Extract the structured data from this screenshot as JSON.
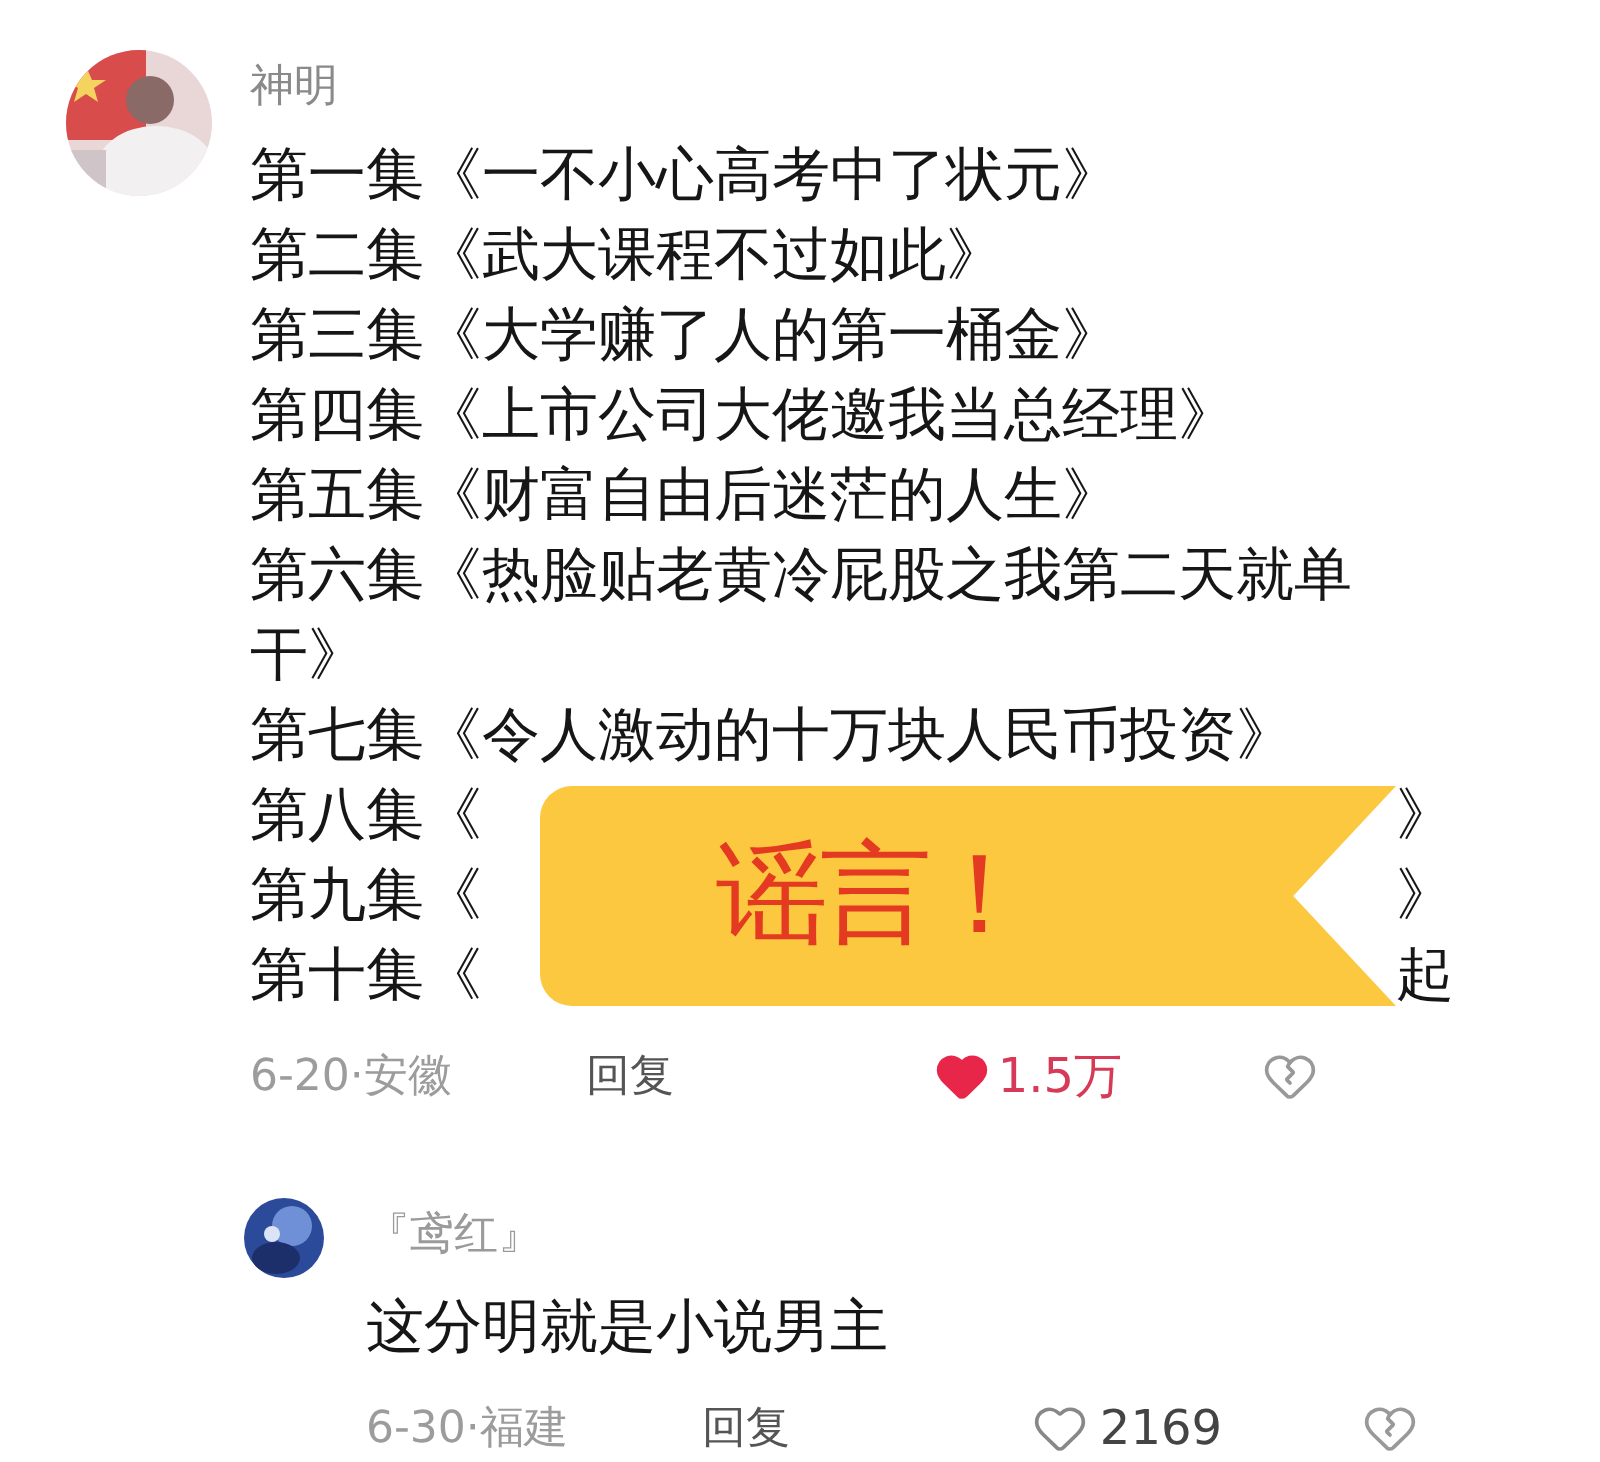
{
  "comments": [
    {
      "kind": "top",
      "name": "神明",
      "lines": [
        {
          "kind": "full",
          "text": "第一集《一不小心高考中了状元》"
        },
        {
          "kind": "full",
          "text": "第二集《武大课程不过如此》"
        },
        {
          "kind": "full",
          "text": "第三集《大学赚了人的第一桶金》"
        },
        {
          "kind": "full",
          "text": "第四集《上市公司大佬邀我当总经理》"
        },
        {
          "kind": "full",
          "text": "第五集《财富自由后迷茫的人生》"
        },
        {
          "kind": "full",
          "text": "第六集《热脸贴老黄冷屁股之我第二天就单干》"
        },
        {
          "kind": "full",
          "text": "第七集《令人激动的十万块人民币投资》"
        },
        {
          "kind": "covered",
          "left": "第八集《",
          "right": "》"
        },
        {
          "kind": "covered",
          "left": "第九集《",
          "right": "》"
        },
        {
          "kind": "covered",
          "left": "第十集《",
          "right": "起"
        }
      ],
      "meta": "6-20·安徽",
      "reply_label": "回复",
      "liked": true,
      "likes": "1.5万"
    },
    {
      "kind": "reply",
      "name": "『鸢红』",
      "lines": [
        {
          "kind": "full",
          "text": "这分明就是小说男主"
        }
      ],
      "meta": "6-30·福建",
      "reply_label": "回复",
      "liked": false,
      "likes": "2169"
    }
  ],
  "sticker": {
    "text": "谣言！"
  }
}
